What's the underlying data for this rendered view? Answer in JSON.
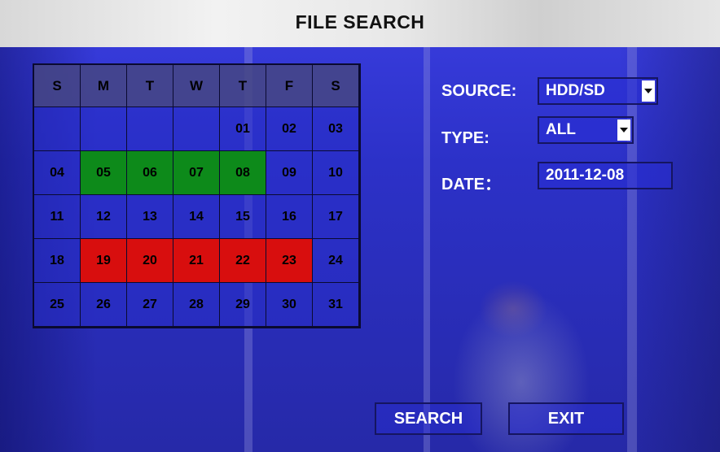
{
  "title": "FILE SEARCH",
  "calendar": {
    "weekdays": [
      "S",
      "M",
      "T",
      "W",
      "T",
      "F",
      "S"
    ],
    "weeks": [
      [
        {
          "d": "",
          "s": "none"
        },
        {
          "d": "",
          "s": "none"
        },
        {
          "d": "",
          "s": "none"
        },
        {
          "d": "",
          "s": "none"
        },
        {
          "d": "01",
          "s": "none"
        },
        {
          "d": "02",
          "s": "none"
        },
        {
          "d": "03",
          "s": "none"
        }
      ],
      [
        {
          "d": "04",
          "s": "none"
        },
        {
          "d": "05",
          "s": "rec"
        },
        {
          "d": "06",
          "s": "rec"
        },
        {
          "d": "07",
          "s": "rec"
        },
        {
          "d": "08",
          "s": "rec"
        },
        {
          "d": "09",
          "s": "none"
        },
        {
          "d": "10",
          "s": "none"
        }
      ],
      [
        {
          "d": "11",
          "s": "none"
        },
        {
          "d": "12",
          "s": "none"
        },
        {
          "d": "13",
          "s": "none"
        },
        {
          "d": "14",
          "s": "none"
        },
        {
          "d": "15",
          "s": "none"
        },
        {
          "d": "16",
          "s": "none"
        },
        {
          "d": "17",
          "s": "none"
        }
      ],
      [
        {
          "d": "18",
          "s": "none"
        },
        {
          "d": "19",
          "s": "alarm"
        },
        {
          "d": "20",
          "s": "alarm"
        },
        {
          "d": "21",
          "s": "alarm"
        },
        {
          "d": "22",
          "s": "alarm"
        },
        {
          "d": "23",
          "s": "alarm"
        },
        {
          "d": "24",
          "s": "none"
        }
      ],
      [
        {
          "d": "25",
          "s": "none"
        },
        {
          "d": "26",
          "s": "none"
        },
        {
          "d": "27",
          "s": "none"
        },
        {
          "d": "28",
          "s": "none"
        },
        {
          "d": "29",
          "s": "none"
        },
        {
          "d": "30",
          "s": "none"
        },
        {
          "d": "31",
          "s": "none"
        }
      ]
    ],
    "colors": {
      "rec": "#0d8a1a",
      "alarm": "#d80e0e"
    }
  },
  "form": {
    "source_label": "SOURCE:",
    "source_value": "HDD/SD",
    "type_label": "TYPE:",
    "type_value": "ALL",
    "date_label": "DATE：",
    "date_value": "2011-12-08"
  },
  "buttons": {
    "search": "SEARCH",
    "exit": "EXIT"
  }
}
